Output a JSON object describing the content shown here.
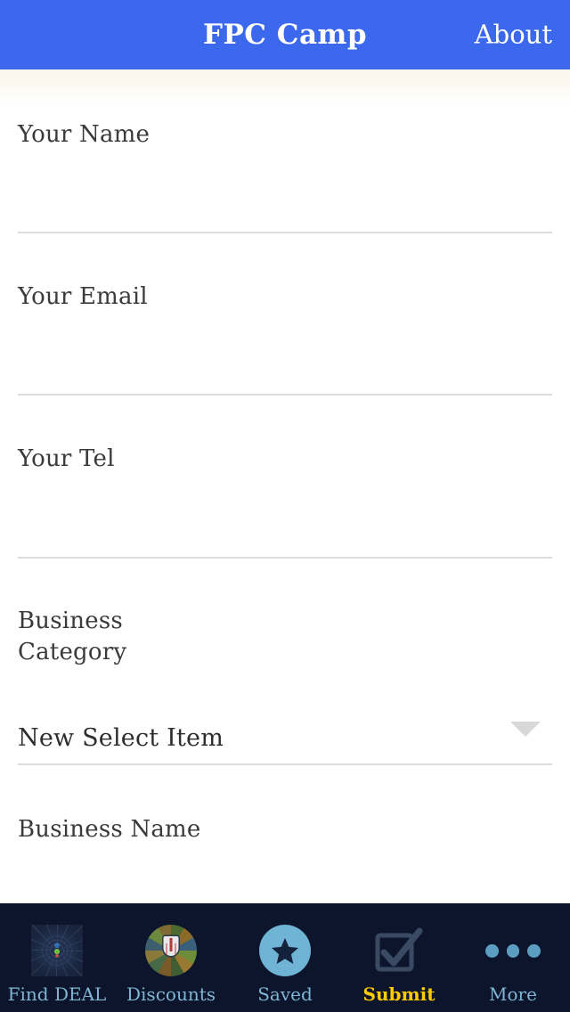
{
  "header": {
    "title": "FPC Camp",
    "about_label": "About",
    "background_color": "#3b68ec",
    "text_color": "#ffffff"
  },
  "form": {
    "fields": [
      {
        "label": "Your Name",
        "value": "",
        "placeholder": "",
        "type": "text"
      },
      {
        "label": "Your Email",
        "value": "",
        "placeholder": "",
        "type": "text"
      },
      {
        "label": "Your Tel",
        "value": "",
        "placeholder": "",
        "type": "text"
      },
      {
        "label": "Business Category",
        "value": "New Select Item",
        "placeholder": "",
        "type": "select"
      },
      {
        "label": "Business Name",
        "value": "",
        "placeholder": "",
        "type": "text"
      }
    ],
    "select_value": "New Select Item",
    "label_color": "#3a3a3a",
    "rule_color": "#dddddd"
  },
  "tabbar": {
    "background_color": "#0c152b",
    "inactive_color": "#7fb6d4",
    "active_color": "#ffcc00",
    "items": [
      {
        "label": "Find DEAL",
        "icon": "web-rosette-image-icon",
        "active": false
      },
      {
        "label": "Discounts",
        "icon": "stained-glass-image-icon",
        "active": false
      },
      {
        "label": "Saved",
        "icon": "star-circle-icon",
        "active": false
      },
      {
        "label": "Submit",
        "icon": "checkbox-check-icon",
        "active": true
      },
      {
        "label": "More",
        "icon": "three-dots-icon",
        "active": false
      }
    ]
  }
}
